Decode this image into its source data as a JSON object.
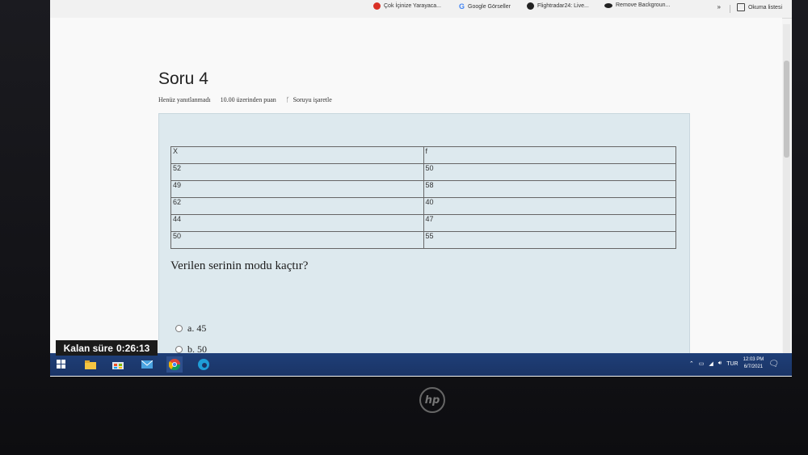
{
  "bookmarks": [
    {
      "label": "Çok İçinize Yarayaca...",
      "color": "#d93025",
      "icon": "red-bookmark-icon"
    },
    {
      "label": "Google Görseller",
      "color": "#4285f4",
      "icon": "google-g-icon"
    },
    {
      "label": "Flightradar24: Live...",
      "color": "#222222",
      "icon": "flightradar-icon"
    },
    {
      "label": "Remove Backgroun...",
      "color": "#222222",
      "icon": "remove-bg-icon"
    }
  ],
  "reading_list": "Okuma listesi",
  "more_bookmarks": "»",
  "question": {
    "title": "Soru 4",
    "status": "Henüz yanıtlanmadı",
    "points": "10.00 üzerinden puan",
    "flag": "Soruyu işaretle",
    "table": {
      "headers": [
        "X",
        "f"
      ],
      "rows": [
        [
          "52",
          "50"
        ],
        [
          "49",
          "58"
        ],
        [
          "62",
          "40"
        ],
        [
          "44",
          "47"
        ],
        [
          "50",
          "55"
        ]
      ]
    },
    "text": "Verilen serinin modu kaçtır?",
    "options": [
      "a. 45",
      "b. 50"
    ]
  },
  "timer": {
    "label": "Kalan süre",
    "value": "0:26:13"
  },
  "taskbar": {
    "lang": "TUR",
    "time": "12:03 PM",
    "date": "6/7/2021"
  },
  "brand": "hp",
  "colors": {
    "taskbar": "#1f3f78",
    "question_bg": "#dde9ee"
  }
}
